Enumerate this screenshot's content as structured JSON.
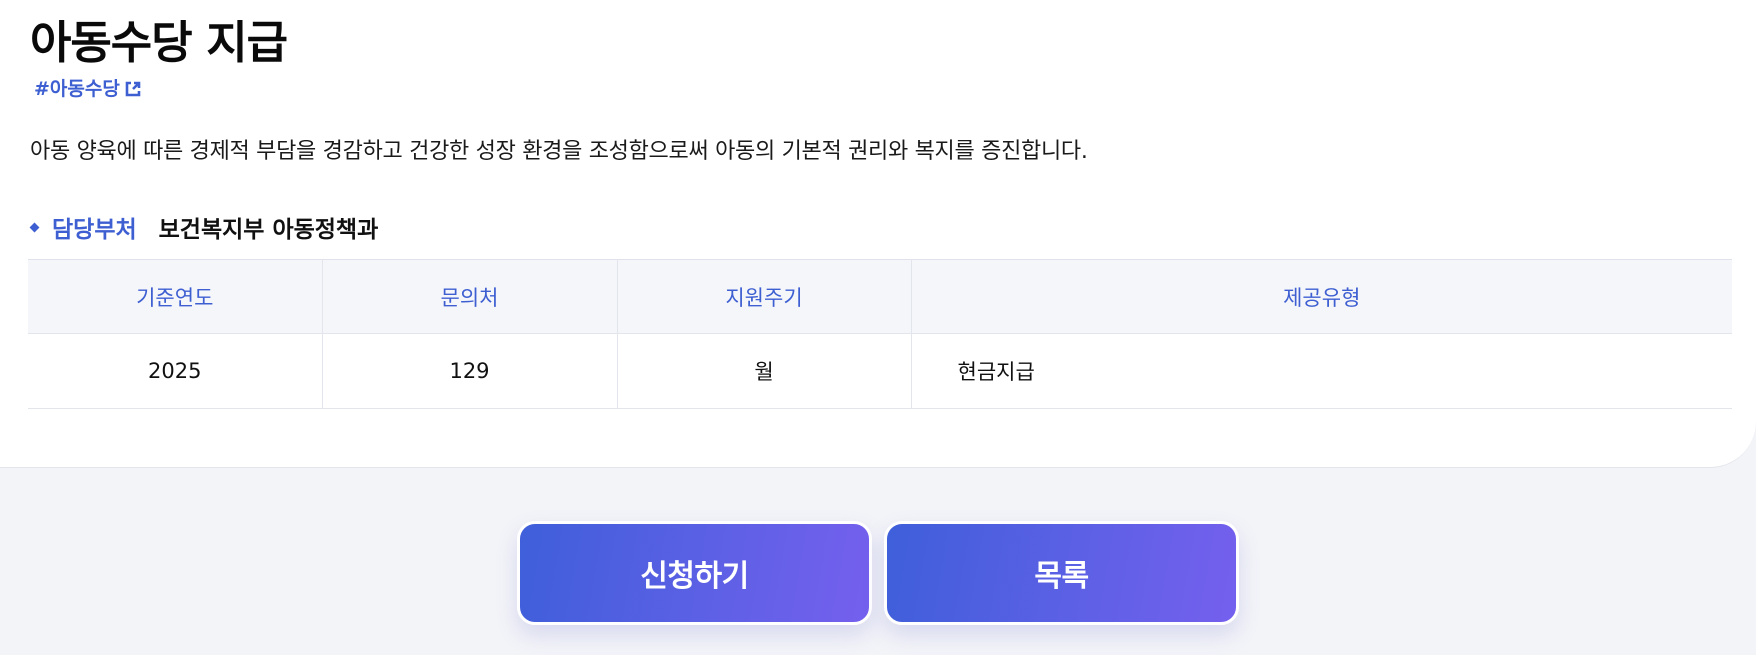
{
  "page": {
    "title": "아동수당 지급",
    "hashtag": "#아동수당",
    "description": "아동 양육에 따른 경제적 부담을 경감하고 건강한 성장 환경을 조성함으로써 아동의 기본적 권리와 복지를 증진합니다.",
    "department": {
      "label": "담당부처",
      "value": "보건복지부 아동정책과"
    }
  },
  "info_table": {
    "headers": [
      "기준연도",
      "문의처",
      "지원주기",
      "제공유형"
    ],
    "row": [
      "2025",
      "129",
      "월",
      "현금지급"
    ]
  },
  "actions": {
    "apply_label": "신청하기",
    "list_label": "목록"
  },
  "colors": {
    "accent": "#3d5fd1",
    "button_gradient_start": "#3f5fda",
    "button_gradient_end": "#7560ee",
    "header_bg": "#f5f6fa",
    "page_bg": "#f3f4f8"
  },
  "icons": {
    "hashtag_link": "external-link-icon",
    "department_bullet": "diamond-bullet-icon"
  }
}
